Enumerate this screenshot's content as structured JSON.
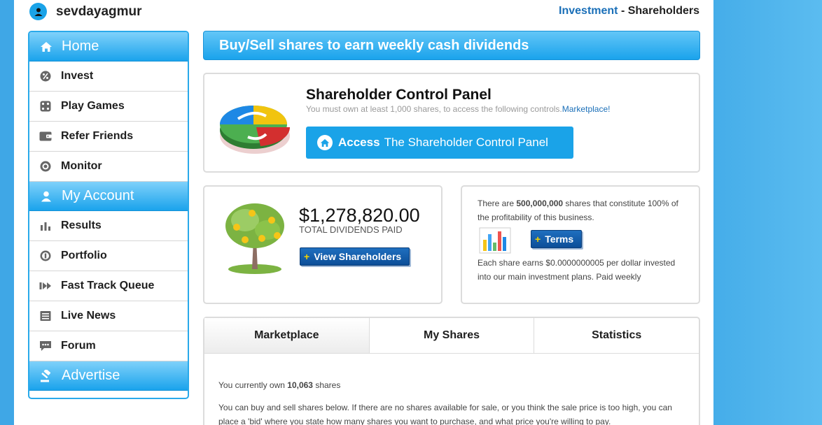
{
  "user": {
    "name": "sevdayagmur",
    "icon": "user-icon"
  },
  "breadcrumb": {
    "section": "Investment",
    "separator": "-",
    "page": "Shareholders"
  },
  "sidebar": {
    "home_label": "Home",
    "my_account_label": "My Account",
    "advertise_label": "Advertise",
    "items_a": [
      {
        "label": "Invest",
        "icon": "percent-icon"
      },
      {
        "label": "Play Games",
        "icon": "dice-icon"
      },
      {
        "label": "Refer Friends",
        "icon": "wallet-icon"
      },
      {
        "label": "Monitor",
        "icon": "target-icon"
      }
    ],
    "items_b": [
      {
        "label": "Results",
        "icon": "bar-chart-icon"
      },
      {
        "label": "Portfolio",
        "icon": "coin-icon"
      },
      {
        "label": "Fast Track Queue",
        "icon": "fast-forward-icon"
      },
      {
        "label": "Live News",
        "icon": "newspaper-icon"
      },
      {
        "label": "Forum",
        "icon": "chat-icon"
      }
    ]
  },
  "banner": {
    "text": "Buy/Sell shares to earn weekly cash dividends"
  },
  "control_panel": {
    "title": "Shareholder Control Panel",
    "subtitle": "You must own at least 1,000 shares, to access the following controls.",
    "subtitle_link": "Marketplace!",
    "button_bold": "Access",
    "button_rest": "The Shareholder Control Panel"
  },
  "dividends": {
    "amount": "$1,278,820.00",
    "label": "TOTAL DIVIDENDS PAID",
    "button": "View Shareholders"
  },
  "shares_info": {
    "p1_pre": "There are ",
    "p1_bold": "500,000,000",
    "p1_post": " shares that constitute 100% of the profitability of this business.",
    "terms_button": "Terms",
    "p2": "Each share earns $0.0000000005 per dollar invested into our main investment plans. Paid weekly"
  },
  "tabs": [
    {
      "label": "Marketplace"
    },
    {
      "label": "My Shares"
    },
    {
      "label": "Statistics"
    }
  ],
  "marketplace": {
    "own_pre": "You currently own ",
    "own_count": "10,063",
    "own_post": " shares",
    "desc": "You can buy and sell shares below. If there are no shares available for sale, or you think the sale price is too high, you can place a 'bid' where you state how many shares you want to purchase, and what price you're willing to pay."
  },
  "colors": {
    "accent": "#1aa3e8",
    "dark_button": "#0c4e98",
    "link": "#1a6fb8",
    "plus": "#f5d300"
  }
}
